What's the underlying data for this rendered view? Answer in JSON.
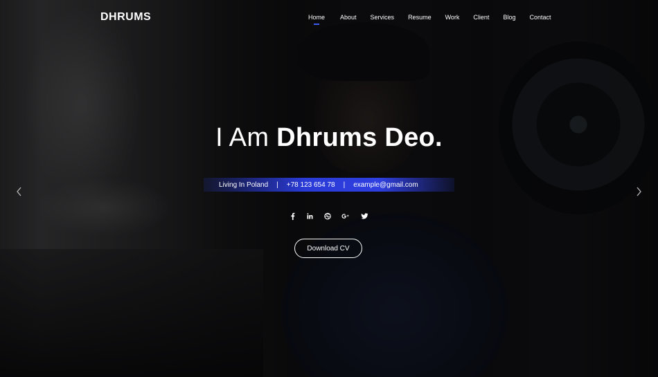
{
  "brand": {
    "logo": "DHRUMS"
  },
  "nav": {
    "items": [
      {
        "label": "Home",
        "active": true
      },
      {
        "label": "About",
        "active": false
      },
      {
        "label": "Services",
        "active": false
      },
      {
        "label": "Resume",
        "active": false
      },
      {
        "label": "Work",
        "active": false
      },
      {
        "label": "Client",
        "active": false
      },
      {
        "label": "Blog",
        "active": false
      },
      {
        "label": "Contact",
        "active": false
      }
    ],
    "accent_color": "#3d5cf5"
  },
  "hero": {
    "greeting": "I Am",
    "name": "Dhrums Deo.",
    "info": {
      "location": "Living In Poland",
      "phone": "+78 123 654 78",
      "email": "example@gmail.com",
      "separator": "|",
      "bar_color": "#2f3fe0"
    },
    "social_icons": [
      "facebook-icon",
      "linkedin-icon",
      "dribbble-icon",
      "google-plus-icon",
      "twitter-icon"
    ],
    "cta_label": "Download CV"
  },
  "slider": {
    "prev_icon": "chevron-left-icon",
    "next_icon": "chevron-right-icon"
  }
}
